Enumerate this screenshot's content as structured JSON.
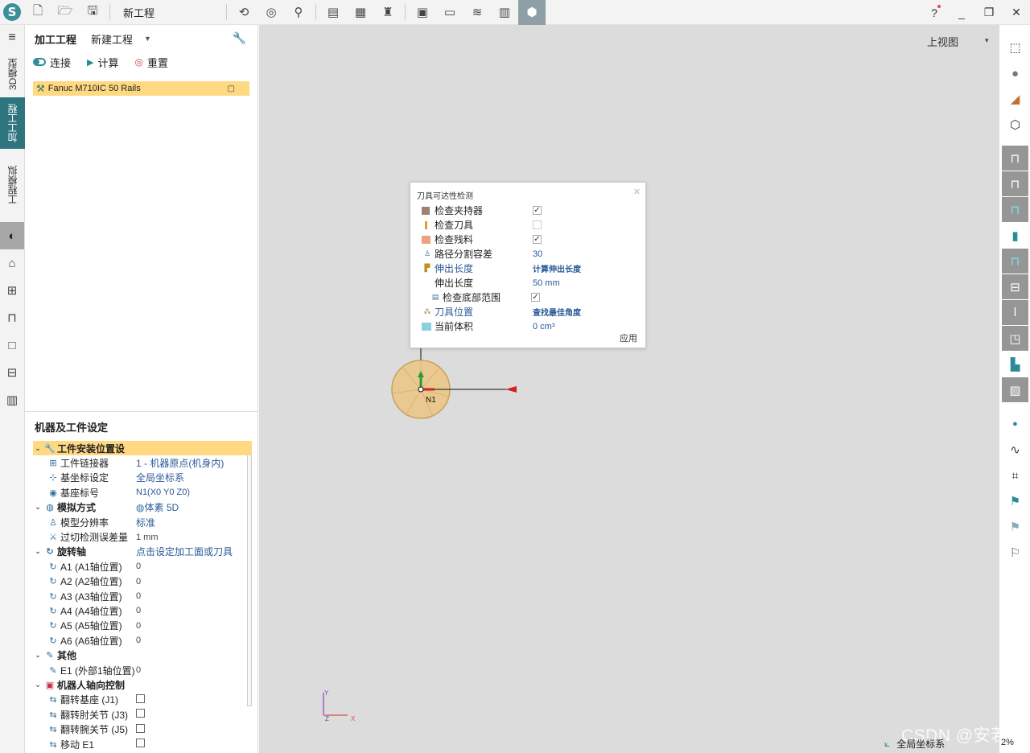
{
  "toolbar": {
    "logo_letter": "S",
    "project_title": "新工程",
    "help_label": "?",
    "win_min": "_",
    "win_max": "❐",
    "win_close": "✕"
  },
  "left_strip": {
    "tabs": [
      {
        "label": "3D模型"
      },
      {
        "label": "加工工程"
      },
      {
        "label": "工程模拟"
      }
    ]
  },
  "project_panel": {
    "title": "加工工程",
    "project_select": "新建工程",
    "actions": {
      "connect": "连接",
      "compute": "计算",
      "reset": "重置"
    },
    "robot_item": "Fanuc M710IC 50 Rails"
  },
  "machine_settings": {
    "title": "机器及工件设定",
    "rows": [
      {
        "key": "工件安装位置设",
        "value": "",
        "group": true,
        "hl": true
      },
      {
        "key": "工件链接器",
        "value": "1 - 机器原点(机身内)"
      },
      {
        "key": "基坐标设定",
        "value": "全局坐标系"
      },
      {
        "key": "基座标号",
        "value": "N1(X0 Y0 Z0)"
      },
      {
        "key": "模拟方式",
        "value": "体素 5D",
        "group": true
      },
      {
        "key": "模型分辨率",
        "value": "标准"
      },
      {
        "key": "过切检测误差量",
        "value": "1 mm"
      },
      {
        "key": "旋转轴",
        "value": "点击设定加工面或刀具",
        "group": true
      },
      {
        "key": "A1 (A1轴位置)",
        "value": "0"
      },
      {
        "key": "A2 (A2轴位置)",
        "value": "0"
      },
      {
        "key": "A3 (A3轴位置)",
        "value": "0"
      },
      {
        "key": "A4 (A4轴位置)",
        "value": "0"
      },
      {
        "key": "A5 (A5轴位置)",
        "value": "0"
      },
      {
        "key": "A6 (A6轴位置)",
        "value": "0"
      },
      {
        "key": "其他",
        "value": "",
        "group": true
      },
      {
        "key": "E1 (外部1轴位置)",
        "value": "0"
      },
      {
        "key": "机器人轴向控制",
        "value": "",
        "group": true
      },
      {
        "key": "翻转基座 (J1)",
        "value": ""
      },
      {
        "key": "翻转肘关节 (J3)",
        "value": ""
      },
      {
        "key": "翻转腕关节 (J5)",
        "value": ""
      },
      {
        "key": "移动 E1",
        "value": ""
      }
    ]
  },
  "viewport": {
    "view_mode": "上视图",
    "caret": "▾",
    "node_label": "N1",
    "axis_y": "Y",
    "axis_x": "X",
    "axis_z": "Z"
  },
  "dialog": {
    "title": "刀具可达性检测",
    "close": "✕",
    "rows": [
      {
        "label": "检查夹持器",
        "type": "check",
        "checked": true
      },
      {
        "label": "检查刀具",
        "type": "check",
        "checked": false
      },
      {
        "label": "检查残料",
        "type": "check",
        "checked": true
      },
      {
        "label": "路径分割容差",
        "type": "value",
        "value": "30"
      },
      {
        "label": "伸出长度",
        "type": "value",
        "value": "计算伸出长度",
        "link": true,
        "bold": true
      },
      {
        "label": "伸出长度",
        "type": "value",
        "value": "50 mm",
        "sub": true
      },
      {
        "label": "检查底部范围",
        "type": "check",
        "checked": true,
        "sub": true
      },
      {
        "label": "刀具位置",
        "type": "value",
        "value": "查找最佳角度",
        "link": true,
        "bold": true
      },
      {
        "label": "当前体积",
        "type": "value",
        "value": "0 cm³"
      }
    ],
    "apply": "应用"
  },
  "status_bar": {
    "coord_system": "全局坐标系",
    "zoom": "2%"
  },
  "watermark": "CSDN @安若ly",
  "colors": {
    "accent": "#2f7580",
    "highlight": "#ffd882",
    "link": "#2a5a98"
  }
}
